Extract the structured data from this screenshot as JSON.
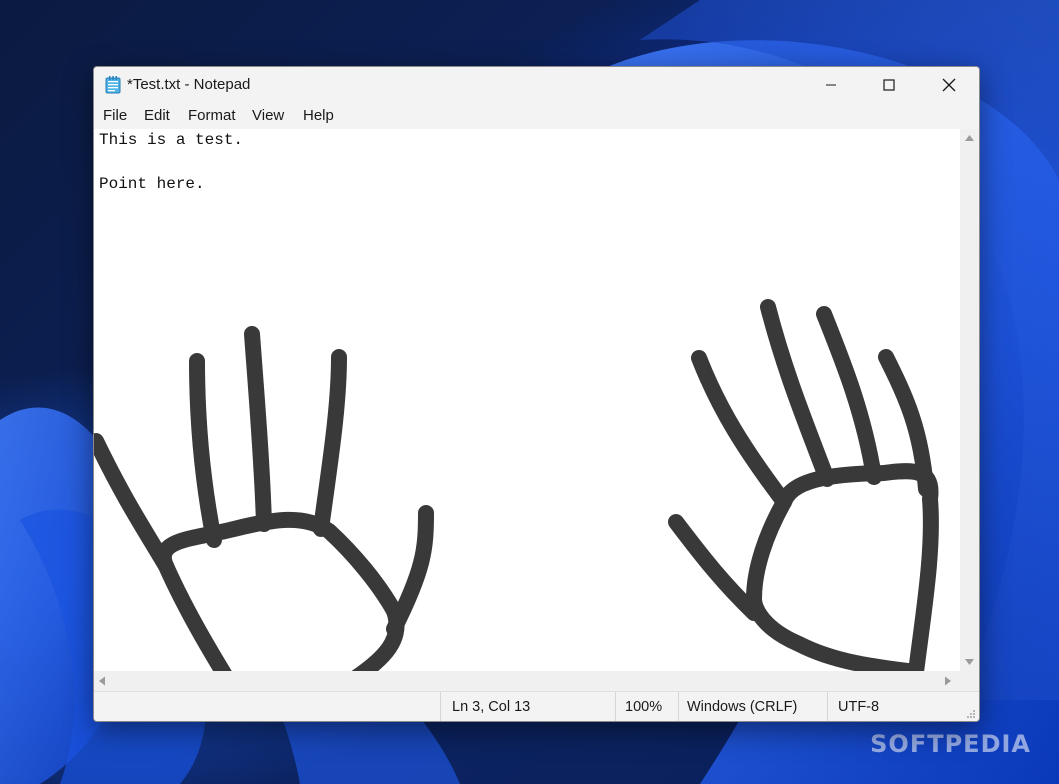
{
  "window": {
    "title": "*Test.txt - Notepad",
    "controls": {
      "minimize": "minimize-icon",
      "maximize": "maximize-icon",
      "close": "close-icon"
    }
  },
  "menu": {
    "file": "File",
    "edit": "Edit",
    "format": "Format",
    "view": "View",
    "help": "Help"
  },
  "editor": {
    "lines": [
      "This is a test.",
      "",
      "Point here."
    ]
  },
  "status": {
    "position": "Ln 3, Col 13",
    "zoom": "100%",
    "line_ending": "Windows (CRLF)",
    "encoding": "UTF-8"
  },
  "watermark": "SOFTPEDIA",
  "colors": {
    "ink": "#333333",
    "window_bg": "#f3f3f3",
    "editor_bg": "#ffffff"
  }
}
